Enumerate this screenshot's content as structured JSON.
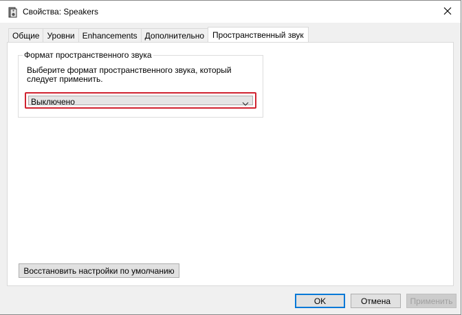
{
  "window": {
    "title": "Свойства: Speakers",
    "icon": "speaker-icon",
    "close_icon": "close-icon"
  },
  "tabs": [
    {
      "label": "Общие",
      "active": false
    },
    {
      "label": "Уровни",
      "active": false
    },
    {
      "label": "Enhancements",
      "active": false
    },
    {
      "label": "Дополнительно",
      "active": false
    },
    {
      "label": "Пространственный звук",
      "active": true
    }
  ],
  "spatial": {
    "group_label": "Формат пространственного звука",
    "description": "Выберите формат пространственного звука, который следует применить.",
    "format_selected": "Выключено",
    "highlight_color": "#d0222f"
  },
  "restore_defaults_label": "Восстановить настройки по умолчанию",
  "footer": {
    "ok_label": "OK",
    "cancel_label": "Отмена",
    "apply_label": "Применить",
    "apply_enabled": false
  }
}
